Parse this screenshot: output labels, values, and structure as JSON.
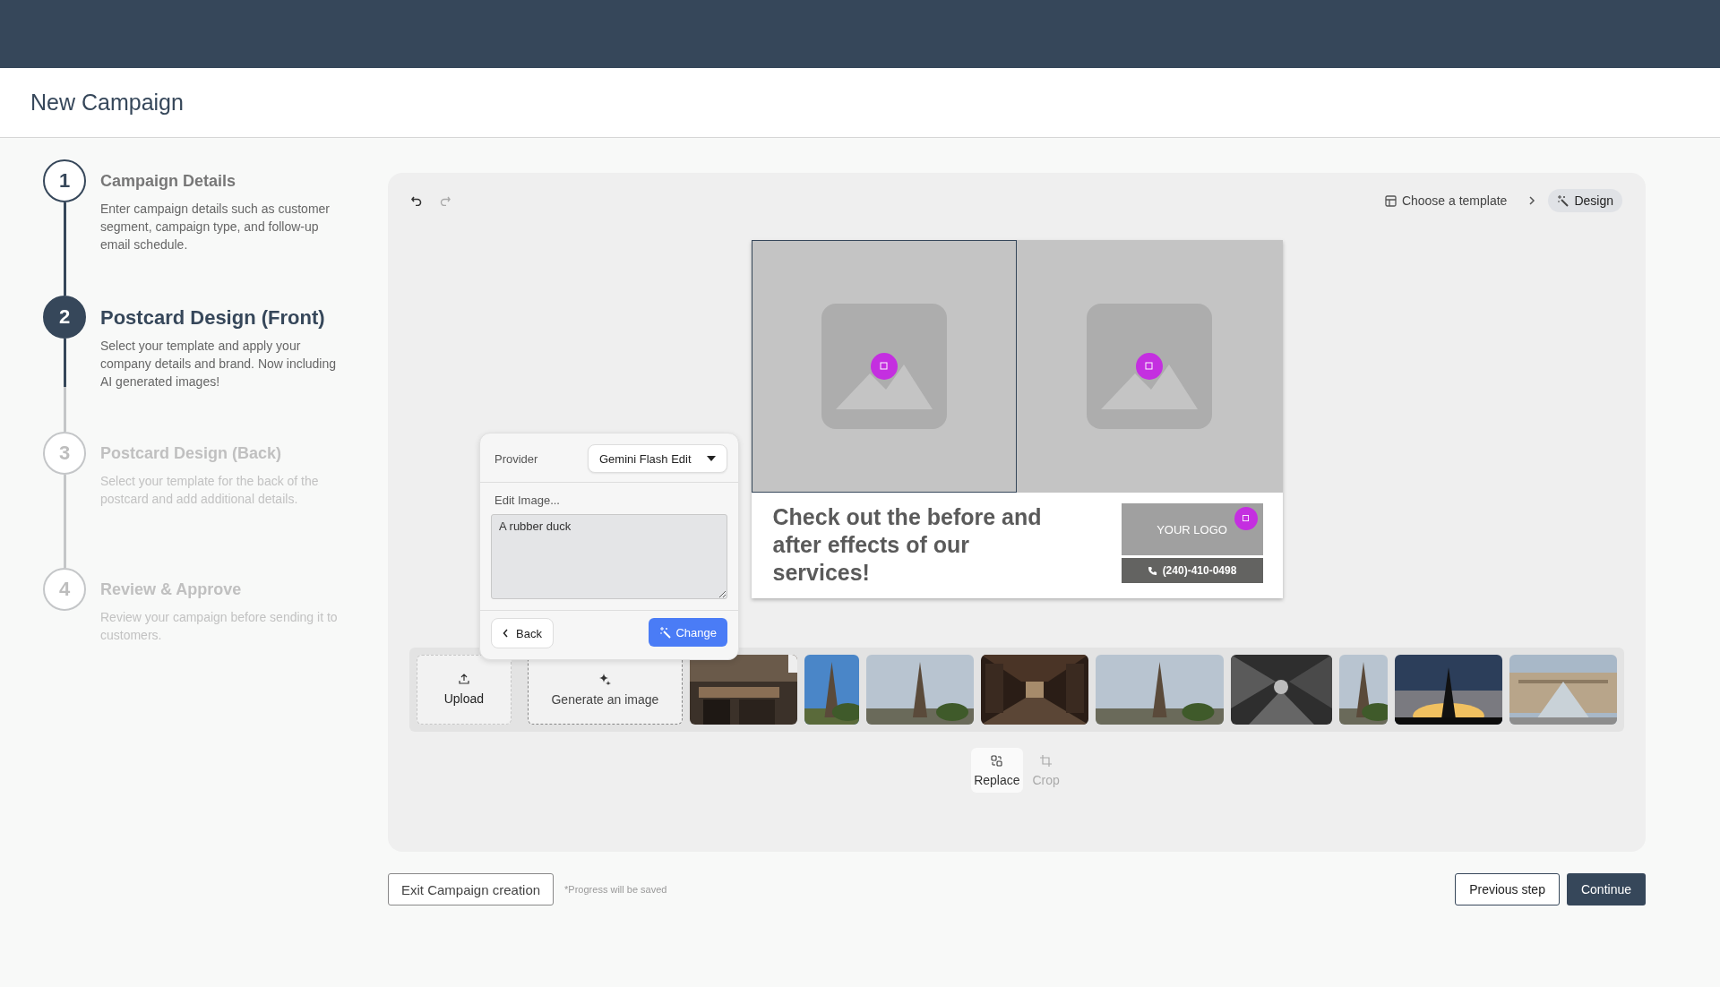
{
  "header": {
    "title": "New Campaign"
  },
  "steps": [
    {
      "number": "1",
      "title": "Campaign Details",
      "description": "Enter campaign details such as customer segment, campaign type, and follow-up email schedule.",
      "done": true,
      "active": false
    },
    {
      "number": "2",
      "title": "Postcard Design (Front)",
      "description": "Select your template and apply your company details and brand. Now including AI generated images!",
      "done": false,
      "active": true
    },
    {
      "number": "3",
      "title": "Postcard Design (Back)",
      "description": "Select your template for the back of the postcard  and add additional details.",
      "done": false,
      "active": false
    },
    {
      "number": "4",
      "title": "Review & Approve",
      "description": "Review your campaign before sending it to customers.",
      "done": false,
      "active": false
    }
  ],
  "breadcrumb": [
    {
      "label": "Choose a template",
      "selected": false
    },
    {
      "label": "Design",
      "selected": true
    }
  ],
  "postcard": {
    "panels": [
      {
        "selected": true
      },
      {
        "selected": false
      }
    ],
    "headline": "Check out the before and after effects of our services!",
    "logo": "YOUR LOGO",
    "phone": "(240)-410-0498"
  },
  "editor": {
    "provider_label": "Provider",
    "provider": "Gemini Flash Edit",
    "prompt_label": "Edit Image...",
    "prompt": "A rubber duck",
    "back": "Back",
    "change": "Change"
  },
  "media": {
    "upload": "Upload",
    "generate": "Generate an image"
  },
  "tools": [
    {
      "label": "Replace",
      "selected": true
    },
    {
      "label": "Crop",
      "selected": false
    }
  ],
  "footer": {
    "exit": "Exit Campaign creation",
    "note": "*Progress will be saved",
    "previous": "Previous step",
    "continue": "Continue"
  }
}
